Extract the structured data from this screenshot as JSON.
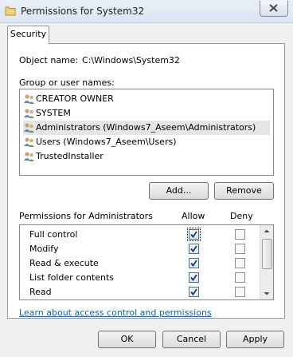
{
  "window": {
    "title": "Permissions for System32",
    "close_icon": "close-icon"
  },
  "tabs": [
    {
      "label": "Security"
    }
  ],
  "object": {
    "label": "Object name:",
    "value": "C:\\Windows\\System32"
  },
  "groups": {
    "label": "Group or user names:",
    "items": [
      {
        "label": "CREATOR OWNER",
        "icon": "users-icon",
        "selected": false
      },
      {
        "label": "SYSTEM",
        "icon": "users-icon",
        "selected": false
      },
      {
        "label": "Administrators (Windows7_Aseem\\Administrators)",
        "icon": "users-icon",
        "selected": true
      },
      {
        "label": "Users (Windows7_Aseem\\Users)",
        "icon": "users-icon",
        "selected": false
      },
      {
        "label": "TrustedInstaller",
        "icon": "users-icon",
        "selected": false
      }
    ]
  },
  "buttons": {
    "add": "Add...",
    "remove": "Remove"
  },
  "permissions": {
    "label": "Permissions for Administrators",
    "allow_header": "Allow",
    "deny_header": "Deny",
    "rows": [
      {
        "name": "Full control",
        "allow": true,
        "deny": false
      },
      {
        "name": "Modify",
        "allow": true,
        "deny": false
      },
      {
        "name": "Read & execute",
        "allow": true,
        "deny": false
      },
      {
        "name": "List folder contents",
        "allow": true,
        "deny": false
      },
      {
        "name": "Read",
        "allow": true,
        "deny": false
      }
    ]
  },
  "help_link": "Learn about access control and permissions",
  "footer": {
    "ok": "OK",
    "cancel": "Cancel",
    "apply": "Apply"
  },
  "colors": {
    "link": "#0066cc",
    "selection": "#e5e5e5",
    "checkmark": "#1f3a60"
  }
}
